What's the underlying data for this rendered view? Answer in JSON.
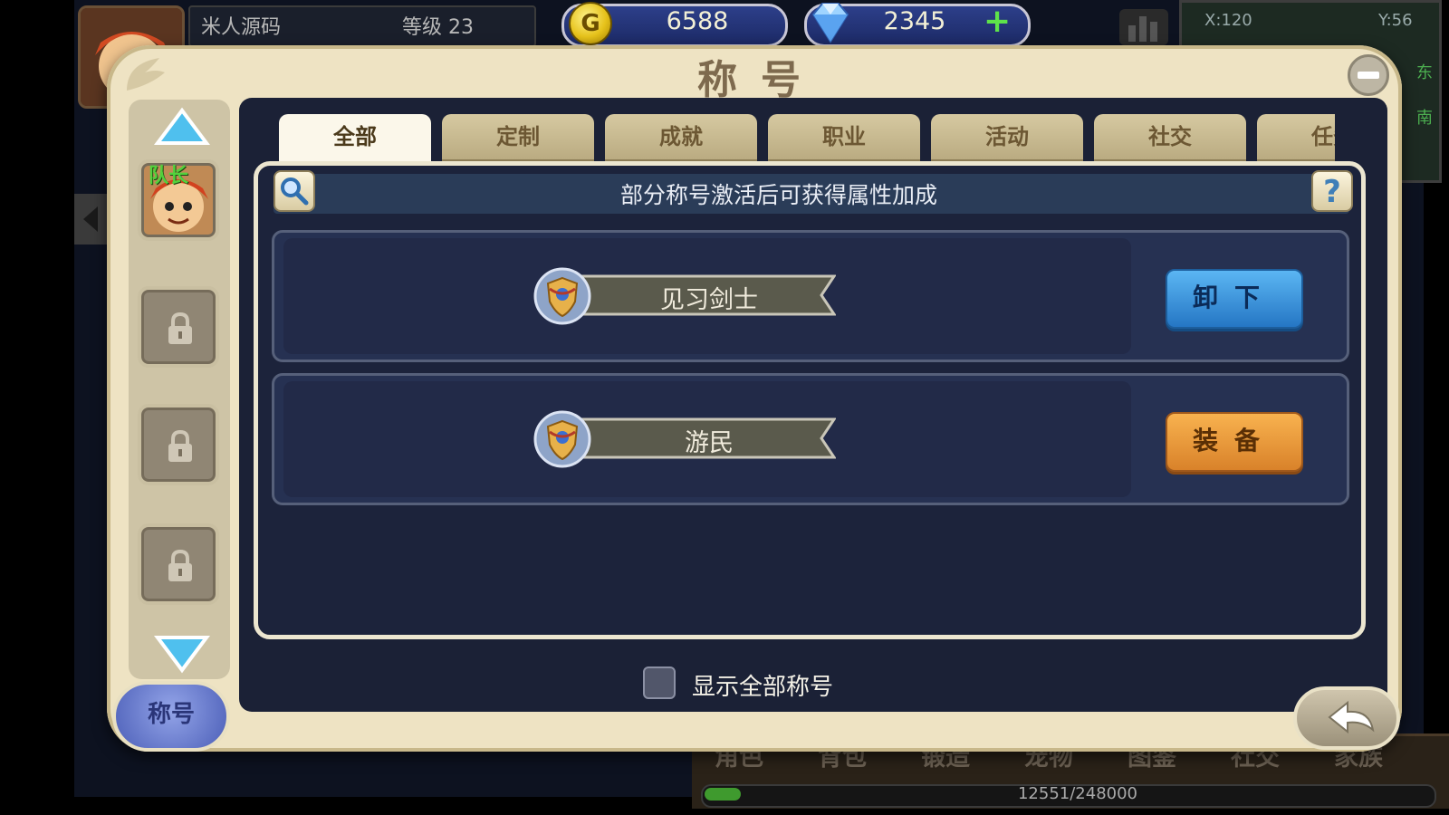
{
  "player": {
    "name": "米人源码",
    "level": "等级 23"
  },
  "currency": {
    "gold": "6588",
    "gold_symbol": "G",
    "gems": "2345",
    "gems_plus": "+"
  },
  "minimap": {
    "x": "X:120",
    "y": "Y:56",
    "dir_east": "东",
    "dir_south": "南"
  },
  "dialog": {
    "title": "称号",
    "tabs": [
      {
        "label": "全部",
        "active": true
      },
      {
        "label": "定制"
      },
      {
        "label": "成就"
      },
      {
        "label": "职业"
      },
      {
        "label": "活动"
      },
      {
        "label": "社交"
      },
      {
        "label": "任务"
      }
    ],
    "info_text": "部分称号激活后可获得属性加成",
    "help_label": "?",
    "titles": [
      {
        "name": "见习剑士",
        "action": "卸下",
        "action_type": "unequip"
      },
      {
        "name": "游民",
        "action": "装备",
        "action_type": "equip"
      }
    ],
    "show_all_label": "显示全部称号",
    "leader_tag": "队长",
    "left_tab_label": "称号"
  },
  "bottom_nav": {
    "items": [
      "角色",
      "背包",
      "锻造",
      "宠物",
      "图鉴",
      "社交",
      "家族"
    ],
    "exp_text": "12551/248000",
    "exp_fraction": 0.0506
  },
  "colors": {
    "dialog_bg": "#eee3c3",
    "panel_bg": "#1b2136",
    "unequip_btn": "#2576c4",
    "equip_btn": "#d9822a"
  }
}
